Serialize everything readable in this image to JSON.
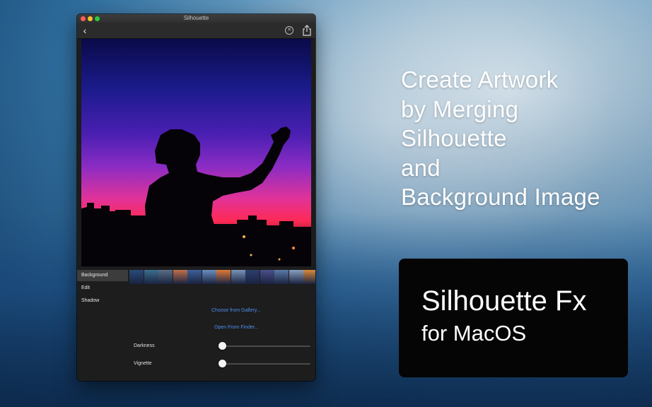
{
  "window": {
    "title": "Silhouette",
    "toolbar": {
      "back_icon": "chevron-left-icon",
      "clear_icon": "clear-circle-icon",
      "share_icon": "share-icon"
    }
  },
  "panel": {
    "sidebar": [
      {
        "label": "Background",
        "active": true
      },
      {
        "label": "Edit",
        "active": false
      },
      {
        "label": "Shadow",
        "active": false
      }
    ],
    "choose_gallery_label": "Choose from Gallery...",
    "open_finder_label": "Open From Finder...",
    "sliders": [
      {
        "label": "Darkness",
        "value": 0.0
      },
      {
        "label": "Vignette",
        "value": 0.0
      }
    ],
    "thumbnail_colors": [
      "#2a4a78",
      "#3b6f8f",
      "#5a6e86",
      "#c0704a",
      "#3f5f9a",
      "#6a8fc0",
      "#e07a3a",
      "#7a95b8",
      "#2d3e6e",
      "#4b4f8a",
      "#5a7aa8",
      "#8aa0c0",
      "#d88a3a"
    ]
  },
  "marketing": {
    "headline_lines": [
      "Create Artwork",
      "by Merging",
      "Silhouette",
      "and",
      "Background Image"
    ],
    "badge_title": "Silhouette Fx",
    "badge_subtitle": "for MacOS"
  }
}
